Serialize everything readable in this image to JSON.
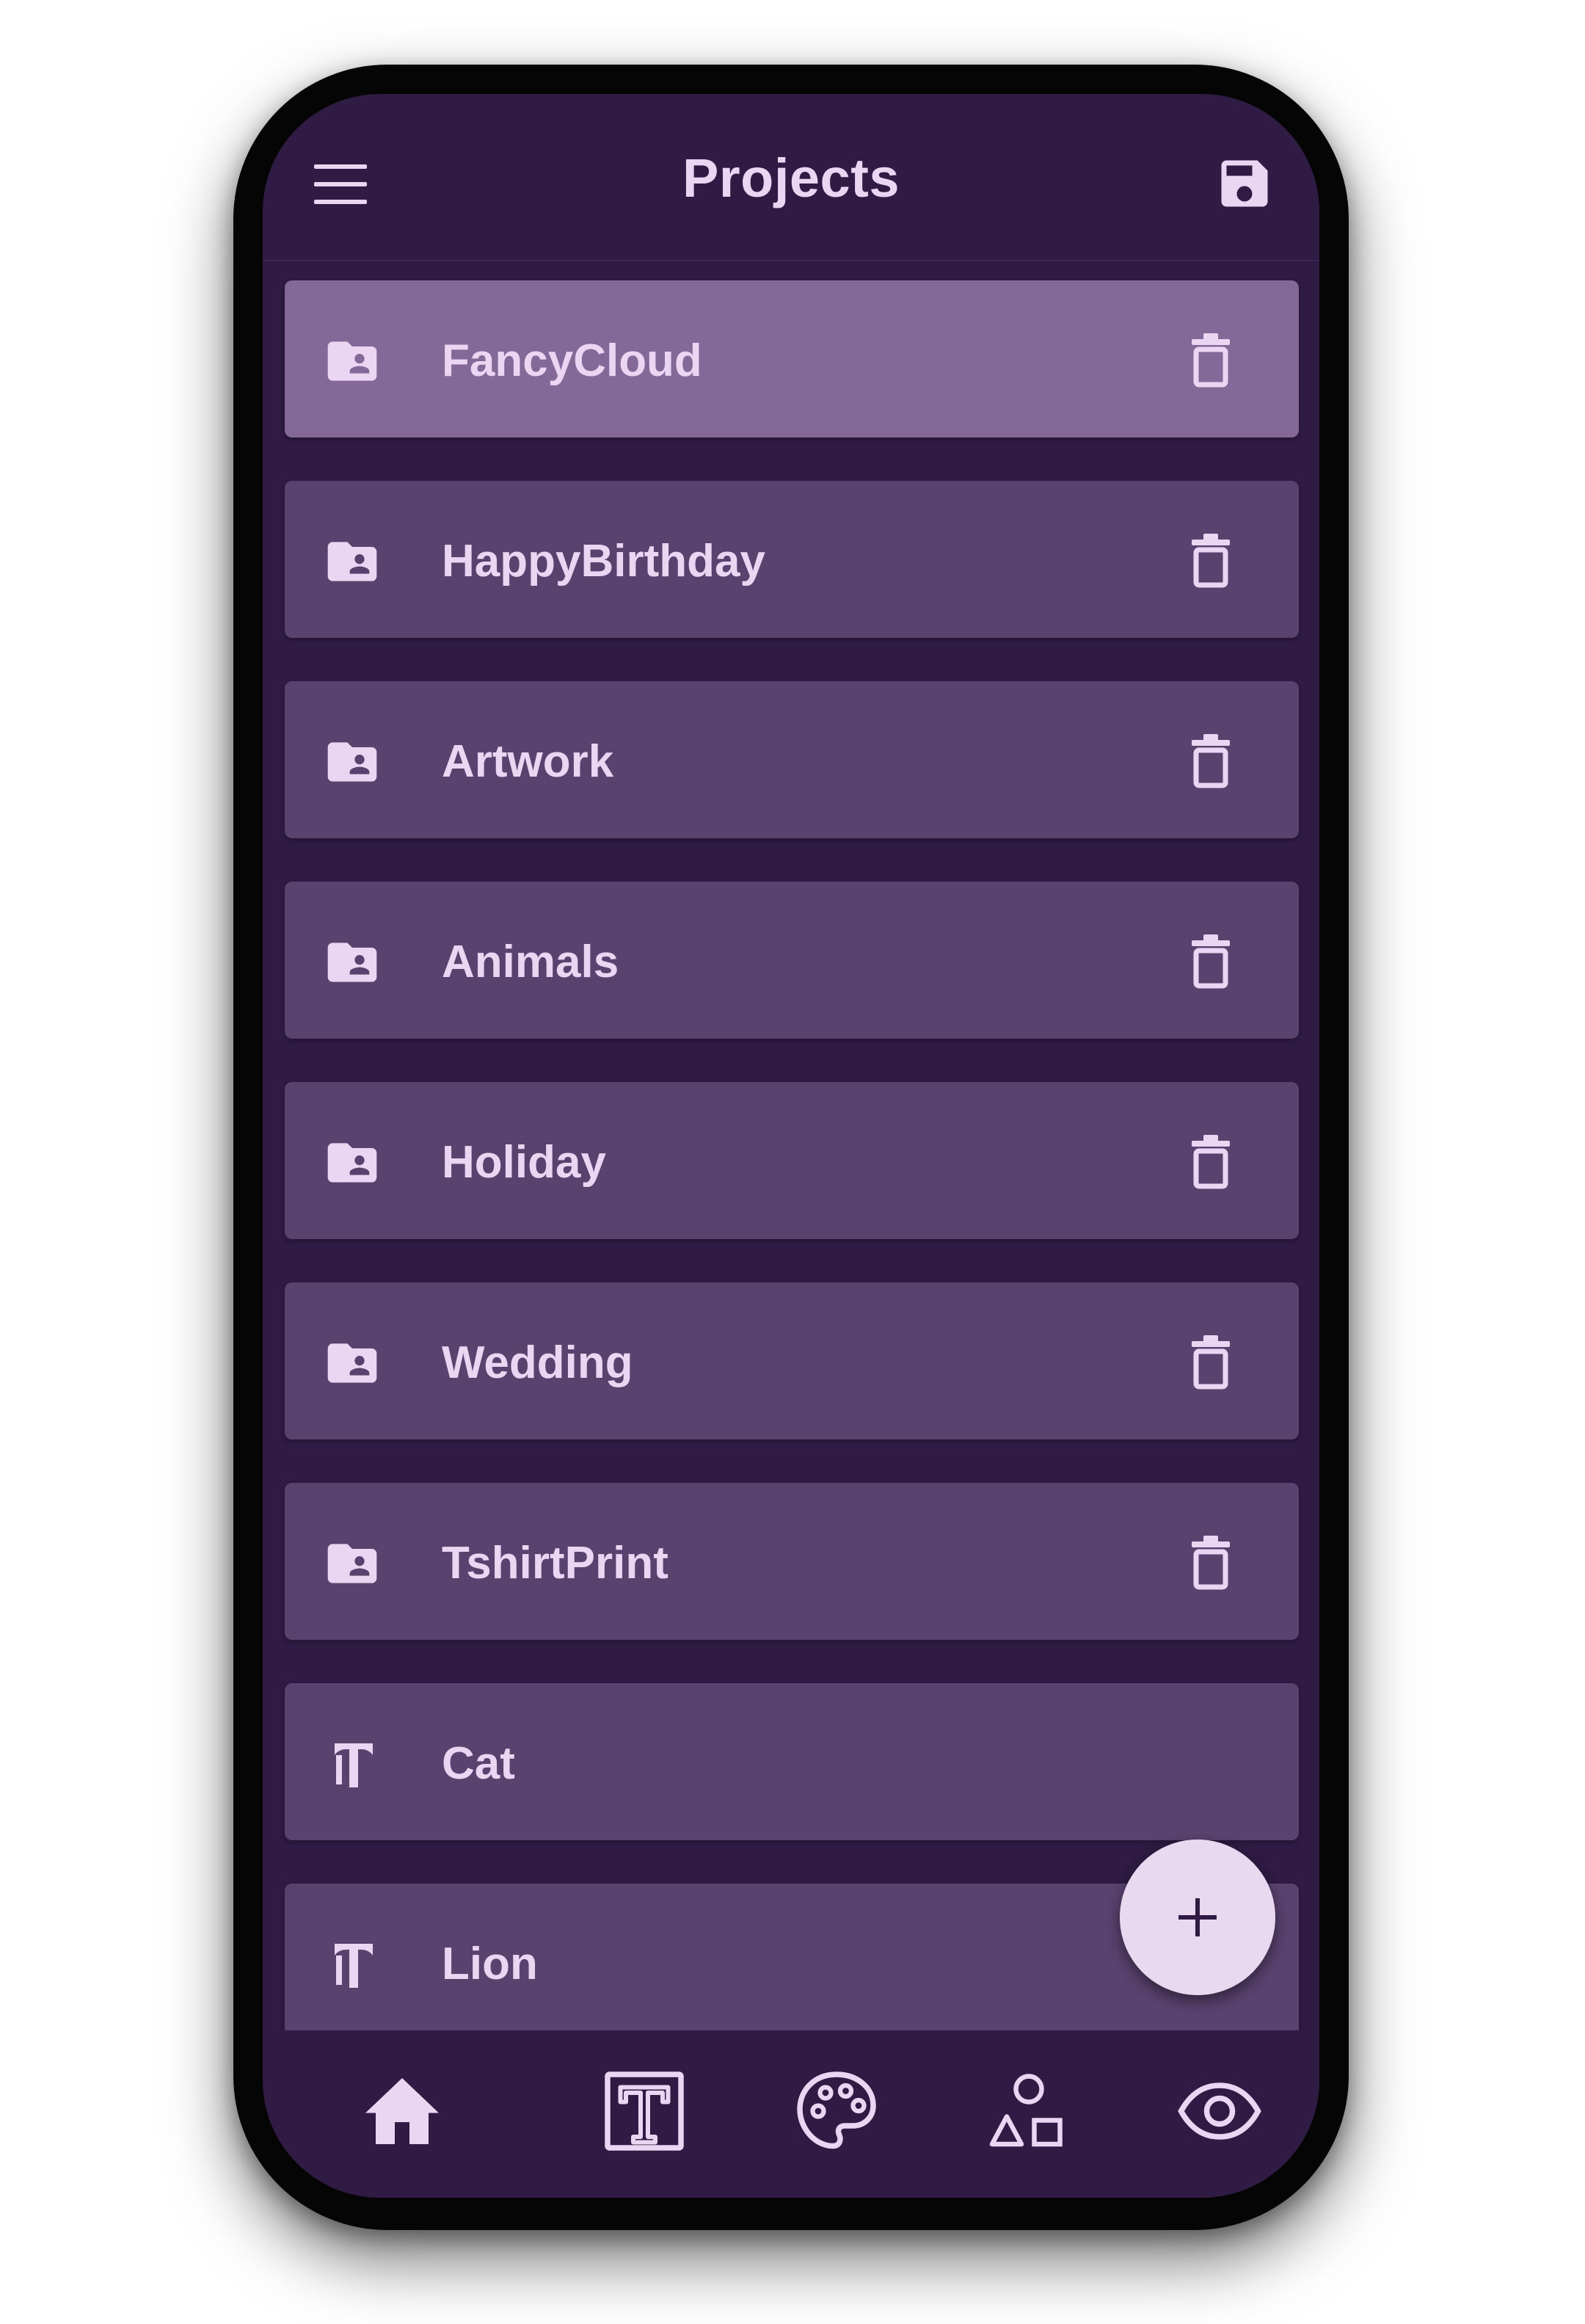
{
  "header": {
    "title": "Projects",
    "menu_icon": "hamburger-menu-icon",
    "save_icon": "floppy-disk-save-icon"
  },
  "projects": [
    {
      "label": "FancyCloud",
      "icon": "folder-shared-icon",
      "selected": true,
      "deletable": true
    },
    {
      "label": "HappyBirthday",
      "icon": "folder-shared-icon",
      "selected": false,
      "deletable": true
    },
    {
      "label": "Artwork",
      "icon": "folder-shared-icon",
      "selected": false,
      "deletable": true
    },
    {
      "label": "Animals",
      "icon": "folder-shared-icon",
      "selected": false,
      "deletable": true
    },
    {
      "label": "Holiday",
      "icon": "folder-shared-icon",
      "selected": false,
      "deletable": true
    },
    {
      "label": "Wedding",
      "icon": "folder-shared-icon",
      "selected": false,
      "deletable": true
    },
    {
      "label": "TshirtPrint",
      "icon": "folder-shared-icon",
      "selected": false,
      "deletable": true
    },
    {
      "label": "Cat",
      "icon": "template-t-icon",
      "selected": false,
      "deletable": false
    },
    {
      "label": "Lion",
      "icon": "template-t-icon",
      "selected": false,
      "deletable": false
    }
  ],
  "fab": {
    "icon": "plus-icon"
  },
  "bottom_nav": [
    {
      "icon": "home-icon",
      "active": true
    },
    {
      "icon": "text-box-icon",
      "active": false
    },
    {
      "icon": "palette-icon",
      "active": false
    },
    {
      "icon": "shapes-icon",
      "active": false
    },
    {
      "icon": "eye-icon",
      "active": false
    }
  ],
  "colors": {
    "background": "#2f1b43",
    "item": "#59426e",
    "item_selected": "#846898",
    "text": "#ead5f2",
    "fab": "#e8d8f0",
    "frame": "#050505"
  }
}
